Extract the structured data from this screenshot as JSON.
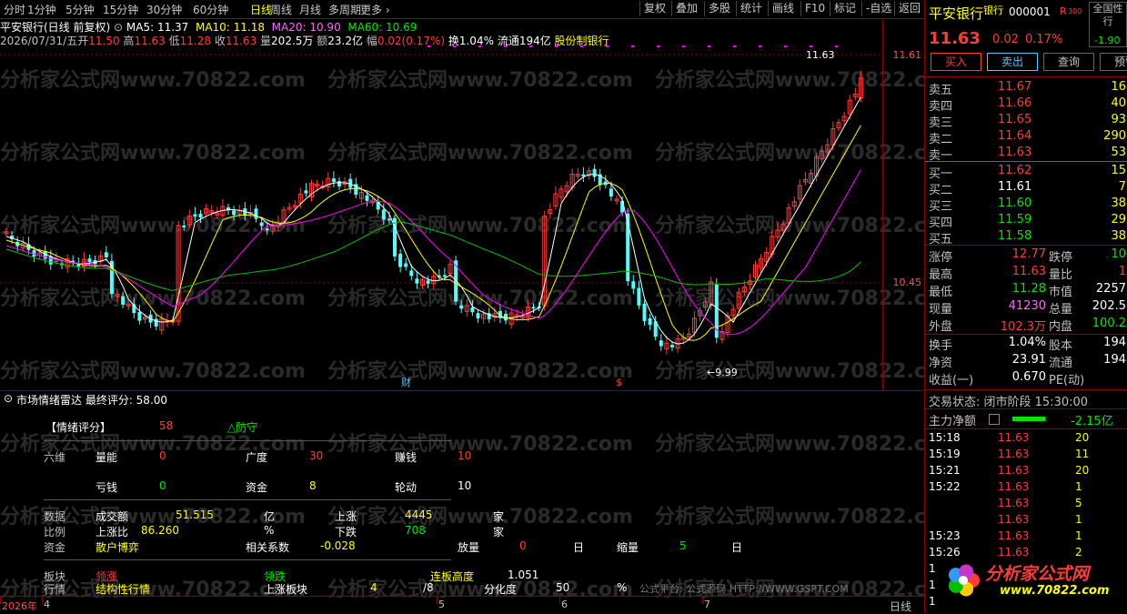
{
  "topbar": {
    "tabs": [
      "分时",
      "1分钟",
      "5分钟",
      "15分钟",
      "30分钟",
      "60分钟",
      "日线",
      "周线",
      "月线",
      "多周期",
      "更多"
    ],
    "active": "日线",
    "buttons": [
      "复权",
      "叠加",
      "多股",
      "统计",
      "画线",
      "F10",
      "标记",
      "-自选",
      "返回"
    ]
  },
  "info": {
    "stock_title": "平安银行(日线 前复权)",
    "ma5": "MA5: 11.37",
    "ma10": "MA10: 11.18",
    "ma20": "MA20: 10.90",
    "ma60": "MA60: 10.69",
    "date": "2026/07/31/五",
    "open_label": "开",
    "open": "11.50",
    "high_label": "高",
    "high": "11.63",
    "low_label": "低",
    "low": "11.28",
    "close_label": "收",
    "close": "11.63",
    "vol_label": "量",
    "vol": "202.5万",
    "amt_label": "额",
    "amt": "23.2亿",
    "chg_label": "幅",
    "chg": "0.02(0.17%)",
    "turnover": "换1.04%",
    "float": "流通194亿",
    "category": "股份制银行"
  },
  "chart_data": {
    "type": "candlestick",
    "axis_labels": [
      "11.61",
      "10.45"
    ],
    "max_label": "11.63",
    "min_label": "9.99",
    "markers": [
      "财",
      "$"
    ],
    "date_axis": [
      "2026年",
      "4",
      "5",
      "6",
      "7"
    ],
    "ma_colors": {
      "ma5": "#ffffff",
      "ma10": "#ffff00",
      "ma20": "#ff00ff",
      "ma60": "#00c000"
    },
    "up_color": "#ff3b3b",
    "down_color": "#54fcfc"
  },
  "panel": {
    "title": "市场情绪雷达 最终评分: 58.00",
    "score_label": "【情绪评分】",
    "score": "58",
    "mood": "△防守",
    "six_dim": "六维",
    "dims": [
      {
        "label": "量能",
        "value": "0"
      },
      {
        "label": "广度",
        "value": "30"
      },
      {
        "label": "赚钱",
        "value": "10"
      },
      {
        "label": "亏钱",
        "value": "0"
      },
      {
        "label": "资金",
        "value": "8"
      },
      {
        "label": "轮动",
        "value": "10"
      }
    ],
    "data_label": "数据",
    "ratio_label": "比例",
    "fund_label": "资金",
    "amount_label": "成交额",
    "amount": "51.515",
    "amount_unit": "亿",
    "up_label": "上涨",
    "up": "4445",
    "up_unit": "家",
    "ratio_up_label": "上涨比",
    "ratio_up": "86.260",
    "ratio_unit": "%",
    "down_label": "下跌",
    "down": "708",
    "down_unit": "家",
    "fund_style": "散户博弈",
    "corr_label": "相关系数",
    "corr": "-0.028",
    "vol_up_label": "放量",
    "vol_up": "0",
    "vol_up_unit": "日",
    "vol_dn_label": "缩量",
    "vol_dn": "5",
    "vol_dn_unit": "日",
    "block_label": "板块",
    "lead_up": "领涨",
    "lead_down": "领跌",
    "limit_height_label": "连板高度",
    "limit_height": "1.051",
    "market_label": "行情",
    "struct": "结构性行情",
    "up_block_label": "上涨板块",
    "up_block": "4",
    "up_block_total": "/8",
    "div_label": "分化度",
    "div": "50",
    "div_unit": "%",
    "footer": "公式平台: 公式源码 HTTP://WWW.GSPT.COM"
  },
  "bottombar": {
    "period": "日线"
  },
  "right": {
    "name": "平安银行",
    "tag": "银行",
    "code": "000001",
    "r": "R",
    "r_num": "300",
    "side_title": "全国性行",
    "side_chg": "-1.90",
    "price": "11.63",
    "change": "0.02",
    "pct": "0.17%",
    "buttons": [
      "买入",
      "卖出",
      "查询",
      "预警"
    ],
    "sells": [
      {
        "label": "卖五",
        "price": "11.67",
        "vol": "16"
      },
      {
        "label": "卖四",
        "price": "11.66",
        "vol": "40"
      },
      {
        "label": "卖三",
        "price": "11.65",
        "vol": "93"
      },
      {
        "label": "卖二",
        "price": "11.64",
        "vol": "290"
      },
      {
        "label": "卖一",
        "price": "11.63",
        "vol": "53"
      }
    ],
    "buys": [
      {
        "label": "买一",
        "price": "11.62",
        "vol": "15"
      },
      {
        "label": "买二",
        "price": "11.61",
        "vol": "7"
      },
      {
        "label": "买三",
        "price": "11.60",
        "vol": "38"
      },
      {
        "label": "买四",
        "price": "11.59",
        "vol": "29"
      },
      {
        "label": "买五",
        "price": "11.58",
        "vol": "38"
      }
    ],
    "stats": [
      {
        "l1": "涨停",
        "v1": "12.77",
        "l2": "跌停",
        "v2": "10"
      },
      {
        "l1": "最高",
        "v1": "11.63",
        "l2": "量比",
        "v2": "1"
      },
      {
        "l1": "最低",
        "v1": "11.28",
        "l2": "市值",
        "v2": "2257"
      },
      {
        "l1": "现量",
        "v1": "41230",
        "l2": "总量",
        "v2": "202.5"
      },
      {
        "l1": "外盘",
        "v1": "102.3万",
        "l2": "内盘",
        "v2": "100.2"
      }
    ],
    "stats2": [
      {
        "l1": "换手",
        "v1": "1.04%",
        "l2": "股本",
        "v2": "194"
      },
      {
        "l1": "净资",
        "v1": "23.91",
        "l2": "流通",
        "v2": "194"
      },
      {
        "l1": "收益(一)",
        "v1": "0.670",
        "l2": "PE(动)",
        "v2": ""
      }
    ],
    "trade_state": "交易状态: 闭市阶段 15:30:00",
    "netflow_label": "主力净额",
    "netflow": "-2.15亿",
    "ticks": [
      {
        "t": "15:18",
        "p": "11.63",
        "v": "20"
      },
      {
        "t": "15:19",
        "p": "11.63",
        "v": "11"
      },
      {
        "t": "15:21",
        "p": "11.63",
        "v": "20"
      },
      {
        "t": "15:22",
        "p": "11.63",
        "v": "1"
      },
      {
        "t": "",
        "p": "11.63",
        "v": "5"
      },
      {
        "t": "",
        "p": "11.63",
        "v": "1"
      },
      {
        "t": "15:23",
        "p": "11.63",
        "v": "1"
      },
      {
        "t": "15:26",
        "p": "11.63",
        "v": "2"
      },
      {
        "t": "1",
        "p": "",
        "v": ""
      },
      {
        "t": "1",
        "p": "",
        "v": ""
      },
      {
        "t": "1",
        "p": "",
        "v": ""
      }
    ],
    "logo_text": "分析家公式网",
    "logo_url": "www.70822.com"
  },
  "watermark": "分析家公式网www.70822.com"
}
